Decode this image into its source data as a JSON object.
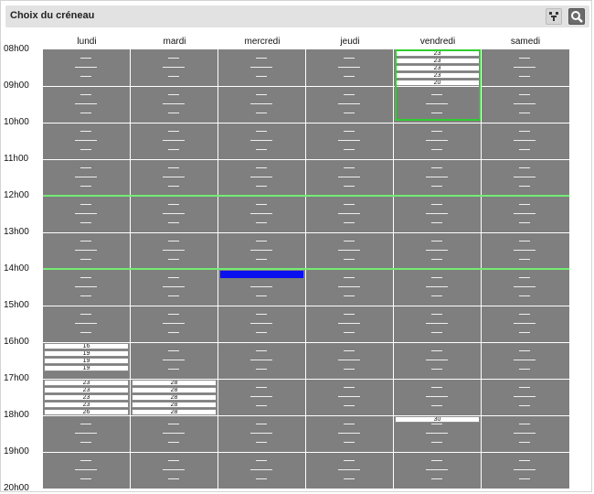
{
  "window": {
    "title": "Choix du créneau"
  },
  "toolbar": {
    "filter_icon": "filter-icon",
    "search_icon": "search-icon"
  },
  "days": [
    "lundi",
    "mardi",
    "mercredi",
    "jeudi",
    "vendredi",
    "samedi"
  ],
  "hours": [
    "08h00",
    "09h00",
    "10h00",
    "11h00",
    "12h00",
    "13h00",
    "14h00",
    "15h00",
    "16h00",
    "17h00",
    "18h00",
    "19h00",
    "20h00"
  ],
  "colors": {
    "grid": "#7f7f7f",
    "lunch_line": "#74ec74",
    "selection": "#0a10ee",
    "highlight": "#2fcd2f"
  },
  "bookings": [
    {
      "day": 0,
      "start": 16.0,
      "labels": [
        "16",
        "19",
        "19",
        "19"
      ]
    },
    {
      "day": 0,
      "start": 17.0,
      "labels": [
        "23",
        "23",
        "23",
        "23",
        "26"
      ]
    },
    {
      "day": 1,
      "start": 17.0,
      "labels": [
        "28",
        "28",
        "28",
        "28",
        "28"
      ]
    },
    {
      "day": 4,
      "start": 8.0,
      "labels": [
        "23",
        "23",
        "23",
        "23",
        "20"
      ]
    },
    {
      "day": 4,
      "start": 18.0,
      "labels": [
        "30"
      ]
    }
  ],
  "selection": {
    "day": 2,
    "start": 14.0,
    "end": 14.25
  },
  "highlight": {
    "day": 4,
    "start": 8.0,
    "end": 10.0
  },
  "lunch_lines": [
    12,
    14
  ]
}
